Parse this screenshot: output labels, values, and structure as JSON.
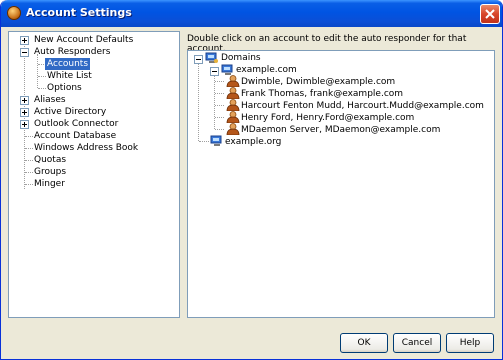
{
  "window": {
    "title": "Account Settings"
  },
  "sidebar": {
    "items": [
      {
        "label": "New Account Defaults"
      },
      {
        "label": "Auto Responders"
      },
      {
        "label": "Accounts"
      },
      {
        "label": "White List"
      },
      {
        "label": "Options"
      },
      {
        "label": "Aliases"
      },
      {
        "label": "Active Directory"
      },
      {
        "label": "Outlook Connector"
      },
      {
        "label": "Account Database"
      },
      {
        "label": "Windows Address Book"
      },
      {
        "label": "Quotas"
      },
      {
        "label": "Groups"
      },
      {
        "label": "Minger"
      }
    ]
  },
  "main": {
    "instructions": "Double click on an account to edit the auto responder for that account.",
    "tree": {
      "root": "Domains",
      "domains": [
        {
          "name": "example.com",
          "accounts": [
            {
              "label": "Dwimble,   Dwimble@example.com"
            },
            {
              "label": "Frank Thomas,   frank@example.com"
            },
            {
              "label": "Harcourt Fenton Mudd,   Harcourt.Mudd@example.com"
            },
            {
              "label": "Henry Ford,   Henry.Ford@example.com"
            },
            {
              "label": "MDaemon Server,   MDaemon@example.com"
            }
          ]
        },
        {
          "name": "example.org",
          "accounts": []
        }
      ]
    }
  },
  "buttons": {
    "ok": "OK",
    "cancel": "Cancel",
    "help": "Help"
  },
  "colors": {
    "titlebar": "#0054e3",
    "selection": "#316ac5",
    "window_bg": "#ece9d8"
  }
}
